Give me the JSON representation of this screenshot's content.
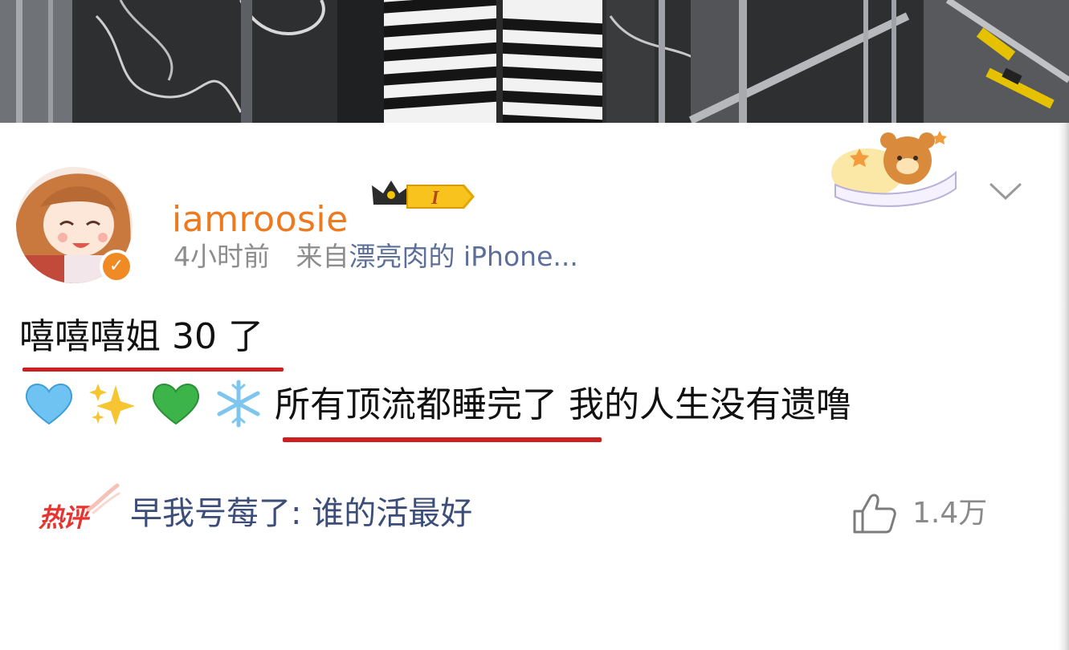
{
  "post": {
    "author": {
      "username": "iamroosie",
      "vip_level": "I",
      "verified": true,
      "avatar": "anime-girl-avatar"
    },
    "meta": {
      "time": "4小时前",
      "source_prefix": "来自",
      "source_device": "漂亮肉的 iPhone..."
    },
    "text_line_1": "嘻嘻嘻姐 30 了",
    "emojis": [
      "blue-heart",
      "sparkles",
      "green-heart",
      "snowflake"
    ],
    "text_line_2": "所有顶流都睡完了 我的人生没有遗噜"
  },
  "hot_comment": {
    "tag": "热评",
    "text": "早我号莓了: 谁的活最好",
    "likes": "1.4万"
  },
  "colors": {
    "username": "#ee7a20",
    "source_device": "#5b6f9a",
    "underline": "#cc1f1f",
    "hot_tag": "#e8342f",
    "hot_comment": "#3c4d7a"
  }
}
